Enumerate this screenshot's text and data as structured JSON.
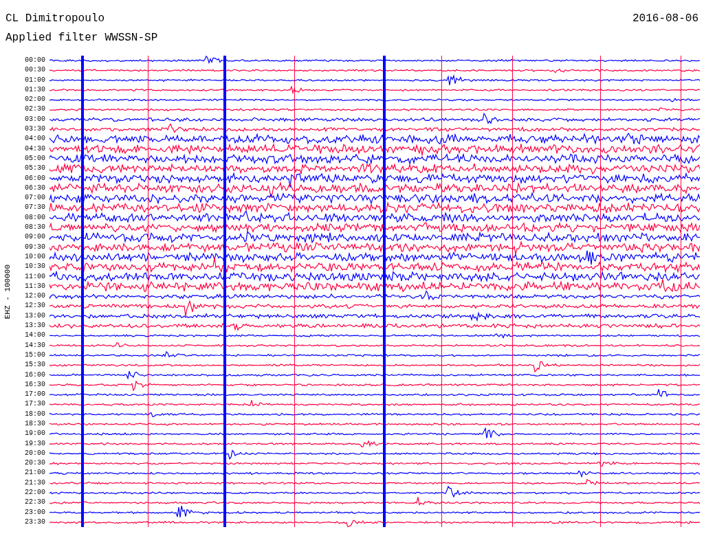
{
  "header": {
    "station": "CL Dimitropoulo",
    "date": "2016-08-06",
    "filter_label": "Applied filter",
    "filter": "WWSSN-SP"
  },
  "axis_label": "EHZ - 100000",
  "traces": [
    {
      "time": "00:00",
      "color": "#0000ff"
    },
    {
      "time": "00:30",
      "color": "#ff0040"
    },
    {
      "time": "01:00",
      "color": "#0000ff"
    },
    {
      "time": "01:30",
      "color": "#ff0040"
    },
    {
      "time": "02:00",
      "color": "#0000ff"
    },
    {
      "time": "02:30",
      "color": "#ff0040"
    },
    {
      "time": "03:00",
      "color": "#0000ff"
    },
    {
      "time": "03:30",
      "color": "#ff0040"
    },
    {
      "time": "04:00",
      "color": "#0000ff"
    },
    {
      "time": "04:30",
      "color": "#ff0040"
    },
    {
      "time": "05:00",
      "color": "#0000ff"
    },
    {
      "time": "05:30",
      "color": "#ff0040"
    },
    {
      "time": "06:00",
      "color": "#0000ff"
    },
    {
      "time": "06:30",
      "color": "#ff0040"
    },
    {
      "time": "07:00",
      "color": "#0000ff"
    },
    {
      "time": "07:30",
      "color": "#ff0040"
    },
    {
      "time": "08:00",
      "color": "#0000ff"
    },
    {
      "time": "08:30",
      "color": "#ff0040"
    },
    {
      "time": "09:00",
      "color": "#0000ff"
    },
    {
      "time": "09:30",
      "color": "#ff0040"
    },
    {
      "time": "10:00",
      "color": "#0000ff"
    },
    {
      "time": "10:30",
      "color": "#ff0040"
    },
    {
      "time": "11:00",
      "color": "#0000ff"
    },
    {
      "time": "11:30",
      "color": "#ff0040"
    },
    {
      "time": "12:00",
      "color": "#0000ff"
    },
    {
      "time": "12:30",
      "color": "#ff0040"
    },
    {
      "time": "13:00",
      "color": "#0000ff"
    },
    {
      "time": "13:30",
      "color": "#ff0040"
    },
    {
      "time": "14:00",
      "color": "#0000ff"
    },
    {
      "time": "14:30",
      "color": "#ff0040"
    },
    {
      "time": "15:00",
      "color": "#0000ff"
    },
    {
      "time": "15:30",
      "color": "#ff0040"
    },
    {
      "time": "16:00",
      "color": "#0000ff"
    },
    {
      "time": "16:30",
      "color": "#ff0040"
    },
    {
      "time": "17:00",
      "color": "#0000ff"
    },
    {
      "time": "17:30",
      "color": "#ff0040"
    },
    {
      "time": "18:00",
      "color": "#0000ff"
    },
    {
      "time": "18:30",
      "color": "#ff0040"
    },
    {
      "time": "19:00",
      "color": "#0000ff"
    },
    {
      "time": "19:30",
      "color": "#ff0040"
    },
    {
      "time": "20:00",
      "color": "#0000ff"
    },
    {
      "time": "20:30",
      "color": "#ff0040"
    },
    {
      "time": "21:00",
      "color": "#0000ff"
    },
    {
      "time": "21:30",
      "color": "#ff0040"
    },
    {
      "time": "22:00",
      "color": "#0000ff"
    },
    {
      "time": "22:30",
      "color": "#ff0040"
    },
    {
      "time": "23:00",
      "color": "#0000ff"
    },
    {
      "time": "23:30",
      "color": "#ff0040"
    }
  ]
}
